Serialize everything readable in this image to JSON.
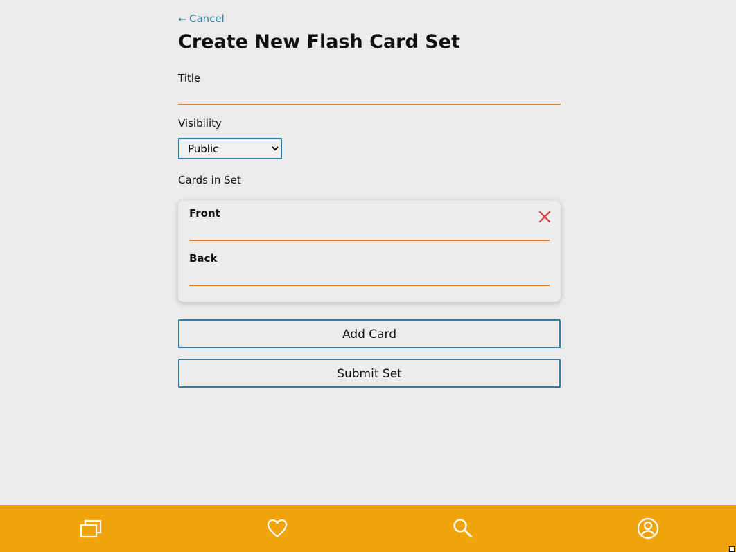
{
  "header": {
    "cancel_arrow": "⭠",
    "cancel_label": "Cancel",
    "page_title": "Create New Flash Card Set"
  },
  "form": {
    "title_label": "Title",
    "title_value": "",
    "visibility_label": "Visibility",
    "visibility_selected": "Public",
    "cards_label": "Cards in Set"
  },
  "card": {
    "front_label": "Front",
    "front_value": "",
    "back_label": "Back",
    "back_value": ""
  },
  "buttons": {
    "add_card": "Add Card",
    "submit_set": "Submit Set"
  },
  "bottom_nav": {
    "items": [
      {
        "icon": "cards-icon"
      },
      {
        "icon": "heart-icon"
      },
      {
        "icon": "search-icon"
      },
      {
        "icon": "profile-icon"
      }
    ]
  },
  "colors": {
    "accent_blue": "#2e7ea6",
    "input_underline": "#e07b24",
    "nav_bar": "#f0a30a",
    "remove_red": "#e0343a",
    "background": "#ebebeb"
  }
}
